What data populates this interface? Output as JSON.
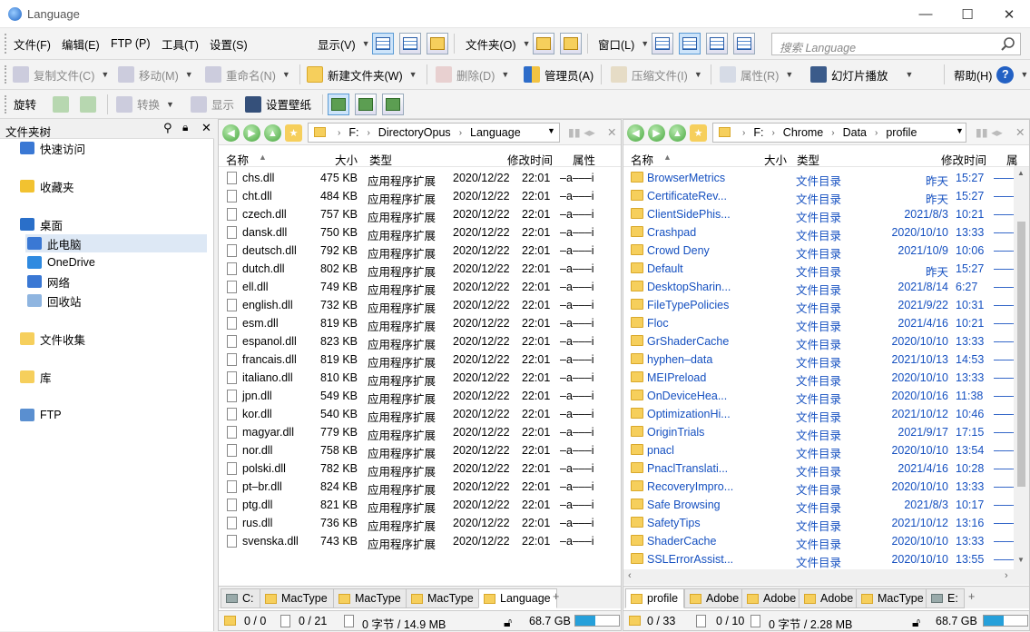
{
  "window": {
    "title": "Language",
    "minimize": "—",
    "maximize": "☐",
    "close": "✕"
  },
  "menubar": {
    "items": [
      "文件(F)",
      "编辑(E)",
      "FTP (P)",
      "工具(T)",
      "设置(S)"
    ],
    "display": "显示(V)",
    "folders": "文件夹(O)",
    "window": "窗口(L)"
  },
  "search": {
    "placeholder": "搜索 Language"
  },
  "toolbar": {
    "copy": "复制文件(C)",
    "move": "移动(M)",
    "rename": "重命名(N)",
    "newfolder": "新建文件夹(W)",
    "delete": "删除(D)",
    "admin": "管理员(A)",
    "compress": "压缩文件(I)",
    "properties": "属性(R)",
    "slideshow": "幻灯片播放",
    "help": "帮助(H)"
  },
  "toolbar3": {
    "rotate": "旋转",
    "convert": "转换",
    "show": "显示",
    "wallpaper": "设置壁纸"
  },
  "tree": {
    "title": "文件夹树",
    "items": [
      {
        "label": "快速访问",
        "icon": "quick-access-icon"
      },
      {
        "label": "收藏夹",
        "icon": "star-icon"
      },
      {
        "label": "桌面",
        "icon": "desktop-icon"
      },
      {
        "label": "此电脑",
        "icon": "computer-icon"
      },
      {
        "label": "OneDrive",
        "icon": "cloud-icon"
      },
      {
        "label": "网络",
        "icon": "network-icon"
      },
      {
        "label": "回收站",
        "icon": "recycle-bin-icon"
      },
      {
        "label": "文件收集",
        "icon": "collection-icon"
      },
      {
        "label": "库",
        "icon": "library-icon"
      },
      {
        "label": "FTP",
        "icon": "ftp-icon"
      }
    ]
  },
  "left": {
    "path": [
      "F:",
      "DirectoryOpus",
      "Language"
    ],
    "columns": {
      "name": "名称",
      "size": "大小",
      "type": "类型",
      "modified": "修改时间",
      "attr": "属性"
    },
    "files": [
      {
        "name": "chs.dll",
        "size": "475 KB",
        "type": "应用程序扩展",
        "date": "2020/12/22",
        "time": "22:01",
        "attr": "–a–––i"
      },
      {
        "name": "cht.dll",
        "size": "484 KB",
        "type": "应用程序扩展",
        "date": "2020/12/22",
        "time": "22:01",
        "attr": "–a–––i"
      },
      {
        "name": "czech.dll",
        "size": "757 KB",
        "type": "应用程序扩展",
        "date": "2020/12/22",
        "time": "22:01",
        "attr": "–a–––i"
      },
      {
        "name": "dansk.dll",
        "size": "750 KB",
        "type": "应用程序扩展",
        "date": "2020/12/22",
        "time": "22:01",
        "attr": "–a–––i"
      },
      {
        "name": "deutsch.dll",
        "size": "792 KB",
        "type": "应用程序扩展",
        "date": "2020/12/22",
        "time": "22:01",
        "attr": "–a–––i"
      },
      {
        "name": "dutch.dll",
        "size": "802 KB",
        "type": "应用程序扩展",
        "date": "2020/12/22",
        "time": "22:01",
        "attr": "–a–––i"
      },
      {
        "name": "ell.dll",
        "size": "749 KB",
        "type": "应用程序扩展",
        "date": "2020/12/22",
        "time": "22:01",
        "attr": "–a–––i"
      },
      {
        "name": "english.dll",
        "size": "732 KB",
        "type": "应用程序扩展",
        "date": "2020/12/22",
        "time": "22:01",
        "attr": "–a–––i"
      },
      {
        "name": "esm.dll",
        "size": "819 KB",
        "type": "应用程序扩展",
        "date": "2020/12/22",
        "time": "22:01",
        "attr": "–a–––i"
      },
      {
        "name": "espanol.dll",
        "size": "823 KB",
        "type": "应用程序扩展",
        "date": "2020/12/22",
        "time": "22:01",
        "attr": "–a–––i"
      },
      {
        "name": "francais.dll",
        "size": "819 KB",
        "type": "应用程序扩展",
        "date": "2020/12/22",
        "time": "22:01",
        "attr": "–a–––i"
      },
      {
        "name": "italiano.dll",
        "size": "810 KB",
        "type": "应用程序扩展",
        "date": "2020/12/22",
        "time": "22:01",
        "attr": "–a–––i"
      },
      {
        "name": "jpn.dll",
        "size": "549 KB",
        "type": "应用程序扩展",
        "date": "2020/12/22",
        "time": "22:01",
        "attr": "–a–––i"
      },
      {
        "name": "kor.dll",
        "size": "540 KB",
        "type": "应用程序扩展",
        "date": "2020/12/22",
        "time": "22:01",
        "attr": "–a–––i"
      },
      {
        "name": "magyar.dll",
        "size": "779 KB",
        "type": "应用程序扩展",
        "date": "2020/12/22",
        "time": "22:01",
        "attr": "–a–––i"
      },
      {
        "name": "nor.dll",
        "size": "758 KB",
        "type": "应用程序扩展",
        "date": "2020/12/22",
        "time": "22:01",
        "attr": "–a–––i"
      },
      {
        "name": "polski.dll",
        "size": "782 KB",
        "type": "应用程序扩展",
        "date": "2020/12/22",
        "time": "22:01",
        "attr": "–a–––i"
      },
      {
        "name": "pt–br.dll",
        "size": "824 KB",
        "type": "应用程序扩展",
        "date": "2020/12/22",
        "time": "22:01",
        "attr": "–a–––i"
      },
      {
        "name": "ptg.dll",
        "size": "821 KB",
        "type": "应用程序扩展",
        "date": "2020/12/22",
        "time": "22:01",
        "attr": "–a–––i"
      },
      {
        "name": "rus.dll",
        "size": "736 KB",
        "type": "应用程序扩展",
        "date": "2020/12/22",
        "time": "22:01",
        "attr": "–a–––i"
      },
      {
        "name": "svenska.dll",
        "size": "743 KB",
        "type": "应用程序扩展",
        "date": "2020/12/22",
        "time": "22:01",
        "attr": "–a–––i"
      }
    ],
    "tabs": [
      "C:",
      "MacType",
      "MacType",
      "MacType",
      "Language"
    ],
    "status": {
      "sel_folders": "0 / 0",
      "sel_files": "0 / 21",
      "bytes": "0 字节 / 14.9 MB",
      "free": "68.7 GB",
      "disk_used": 0.45
    }
  },
  "right": {
    "path": [
      "F:",
      "Chrome",
      "Data",
      "profile"
    ],
    "columns": {
      "name": "名称",
      "size": "大小",
      "type": "类型",
      "modified": "修改时间",
      "attr": "属"
    },
    "folders": [
      {
        "name": "BrowserMetrics",
        "type": "文件目录",
        "date": "昨天",
        "time": "15:27",
        "attr": "––––"
      },
      {
        "name": "CertificateRev...",
        "type": "文件目录",
        "date": "昨天",
        "time": "15:27",
        "attr": "––––"
      },
      {
        "name": "ClientSidePhis...",
        "type": "文件目录",
        "date": "2021/8/3",
        "time": "10:21",
        "attr": "––––"
      },
      {
        "name": "Crashpad",
        "type": "文件目录",
        "date": "2020/10/10",
        "time": "13:33",
        "attr": "––––"
      },
      {
        "name": "Crowd Deny",
        "type": "文件目录",
        "date": "2021/10/9",
        "time": "10:06",
        "attr": "––––"
      },
      {
        "name": "Default",
        "type": "文件目录",
        "date": "昨天",
        "time": "15:27",
        "attr": "––––"
      },
      {
        "name": "DesktopSharin...",
        "type": "文件目录",
        "date": "2021/8/14",
        "time": "6:27",
        "attr": "––––"
      },
      {
        "name": "FileTypePolicies",
        "type": "文件目录",
        "date": "2021/9/22",
        "time": "10:31",
        "attr": "––––"
      },
      {
        "name": "Floc",
        "type": "文件目录",
        "date": "2021/4/16",
        "time": "10:21",
        "attr": "––––"
      },
      {
        "name": "GrShaderCache",
        "type": "文件目录",
        "date": "2020/10/10",
        "time": "13:33",
        "attr": "––––"
      },
      {
        "name": "hyphen–data",
        "type": "文件目录",
        "date": "2021/10/13",
        "time": "14:53",
        "attr": "––––"
      },
      {
        "name": "MEIPreload",
        "type": "文件目录",
        "date": "2020/10/10",
        "time": "13:33",
        "attr": "––––"
      },
      {
        "name": "OnDeviceHea...",
        "type": "文件目录",
        "date": "2020/10/16",
        "time": "11:38",
        "attr": "––––"
      },
      {
        "name": "OptimizationHi...",
        "type": "文件目录",
        "date": "2021/10/12",
        "time": "10:46",
        "attr": "––––"
      },
      {
        "name": "OriginTrials",
        "type": "文件目录",
        "date": "2021/9/17",
        "time": "17:15",
        "attr": "––––"
      },
      {
        "name": "pnacl",
        "type": "文件目录",
        "date": "2020/10/10",
        "time": "13:54",
        "attr": "––––"
      },
      {
        "name": "PnaclTranslati...",
        "type": "文件目录",
        "date": "2021/4/16",
        "time": "10:28",
        "attr": "––––"
      },
      {
        "name": "RecoveryImpro...",
        "type": "文件目录",
        "date": "2020/10/10",
        "time": "13:33",
        "attr": "––––"
      },
      {
        "name": "Safe Browsing",
        "type": "文件目录",
        "date": "2021/8/3",
        "time": "10:17",
        "attr": "––––"
      },
      {
        "name": "SafetyTips",
        "type": "文件目录",
        "date": "2021/10/12",
        "time": "13:16",
        "attr": "––––"
      },
      {
        "name": "ShaderCache",
        "type": "文件目录",
        "date": "2020/10/10",
        "time": "13:33",
        "attr": "––––"
      },
      {
        "name": "SSLErrorAssist...",
        "type": "文件目录",
        "date": "2020/10/10",
        "time": "13:55",
        "attr": "––––"
      }
    ],
    "tabs": [
      "profile",
      "Adobe",
      "Adobe",
      "Adobe",
      "MacType",
      "E:"
    ],
    "status": {
      "sel_folders": "0 / 33",
      "sel_files": "0 / 10",
      "bytes": "0 字节 / 2.28 MB",
      "free": "68.7 GB",
      "disk_used": 0.45
    }
  },
  "colors": {
    "accent": "#1550c0",
    "folder": "#f6cf5c",
    "active_view": "#cde4fa"
  }
}
